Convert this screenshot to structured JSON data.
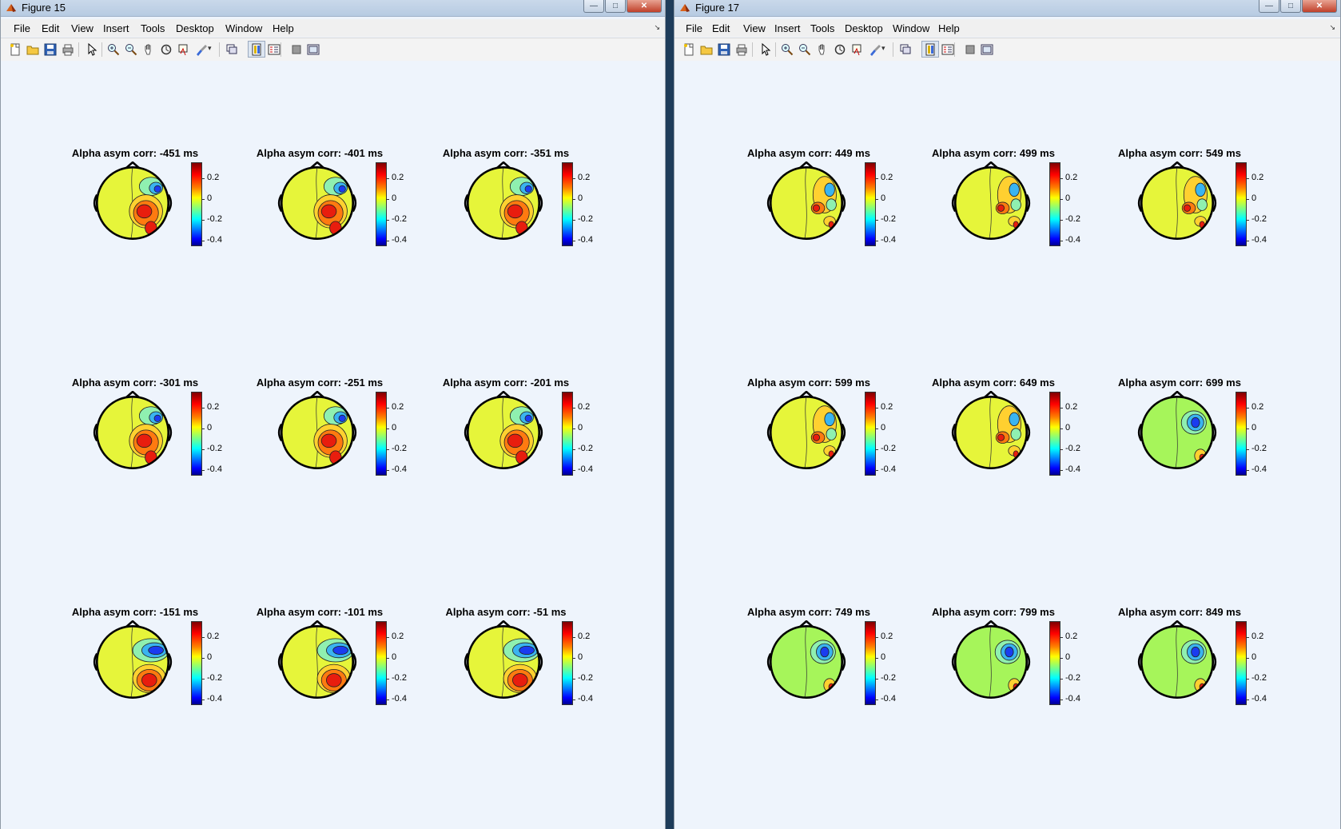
{
  "windows": [
    {
      "id": "figure-15",
      "title": "Figure 15",
      "menu": [
        "File",
        "Edit",
        "View",
        "Insert",
        "Tools",
        "Desktop",
        "Window",
        "Help"
      ],
      "plots": [
        {
          "title": "Alpha asym corr: -451 ms",
          "pattern": "early"
        },
        {
          "title": "Alpha asym corr: -401 ms",
          "pattern": "early"
        },
        {
          "title": "Alpha asym corr: -351 ms",
          "pattern": "early"
        },
        {
          "title": "Alpha asym corr: -301 ms",
          "pattern": "early"
        },
        {
          "title": "Alpha asym corr: -251 ms",
          "pattern": "early"
        },
        {
          "title": "Alpha asym corr: -201 ms",
          "pattern": "early"
        },
        {
          "title": "Alpha asym corr: -151 ms",
          "pattern": "late"
        },
        {
          "title": "Alpha asym corr: -101 ms",
          "pattern": "late"
        },
        {
          "title": "Alpha asym corr: -51 ms",
          "pattern": "late"
        }
      ]
    },
    {
      "id": "figure-17",
      "title": "Figure 17",
      "menu": [
        "File",
        "Edit",
        "View",
        "Insert",
        "Tools",
        "Desktop",
        "Window",
        "Help"
      ],
      "plots": [
        {
          "title": "Alpha asym corr: 449 ms",
          "pattern": "mixed"
        },
        {
          "title": "Alpha asym corr: 499 ms",
          "pattern": "mixed"
        },
        {
          "title": "Alpha asym corr: 549 ms",
          "pattern": "mixed"
        },
        {
          "title": "Alpha asym corr: 599 ms",
          "pattern": "mixed"
        },
        {
          "title": "Alpha asym corr: 649 ms",
          "pattern": "mixed"
        },
        {
          "title": "Alpha asym corr: 699 ms",
          "pattern": "green"
        },
        {
          "title": "Alpha asym corr: 749 ms",
          "pattern": "green"
        },
        {
          "title": "Alpha asym corr: 799 ms",
          "pattern": "green"
        },
        {
          "title": "Alpha asym corr: 849 ms",
          "pattern": "green"
        }
      ]
    }
  ],
  "colorbar": {
    "ticks": [
      "0.2",
      "0",
      "-0.2",
      "-0.4"
    ],
    "tick_values": [
      0.2,
      0,
      -0.2,
      -0.4
    ],
    "range": [
      -0.45,
      0.35
    ],
    "colormap": "jet"
  },
  "toolbar_icons": [
    "new-figure-icon",
    "open-file-icon",
    "save-icon",
    "print-icon",
    "select-arrow-icon",
    "zoom-in-icon",
    "zoom-out-icon",
    "pan-hand-icon",
    "rotate-3d-icon",
    "data-cursor-icon",
    "brush-icon",
    "link-plot-icon",
    "colorbar-icon",
    "legend-icon",
    "hide-plot-tools-icon",
    "show-plot-tools-icon"
  ],
  "colors": {
    "panel_bg": "#eef4fc",
    "head_fill_yellow": "#e6f53a",
    "head_fill_green": "#a6f55a",
    "red": "#e81d0e",
    "blue": "#1a3cf0"
  }
}
